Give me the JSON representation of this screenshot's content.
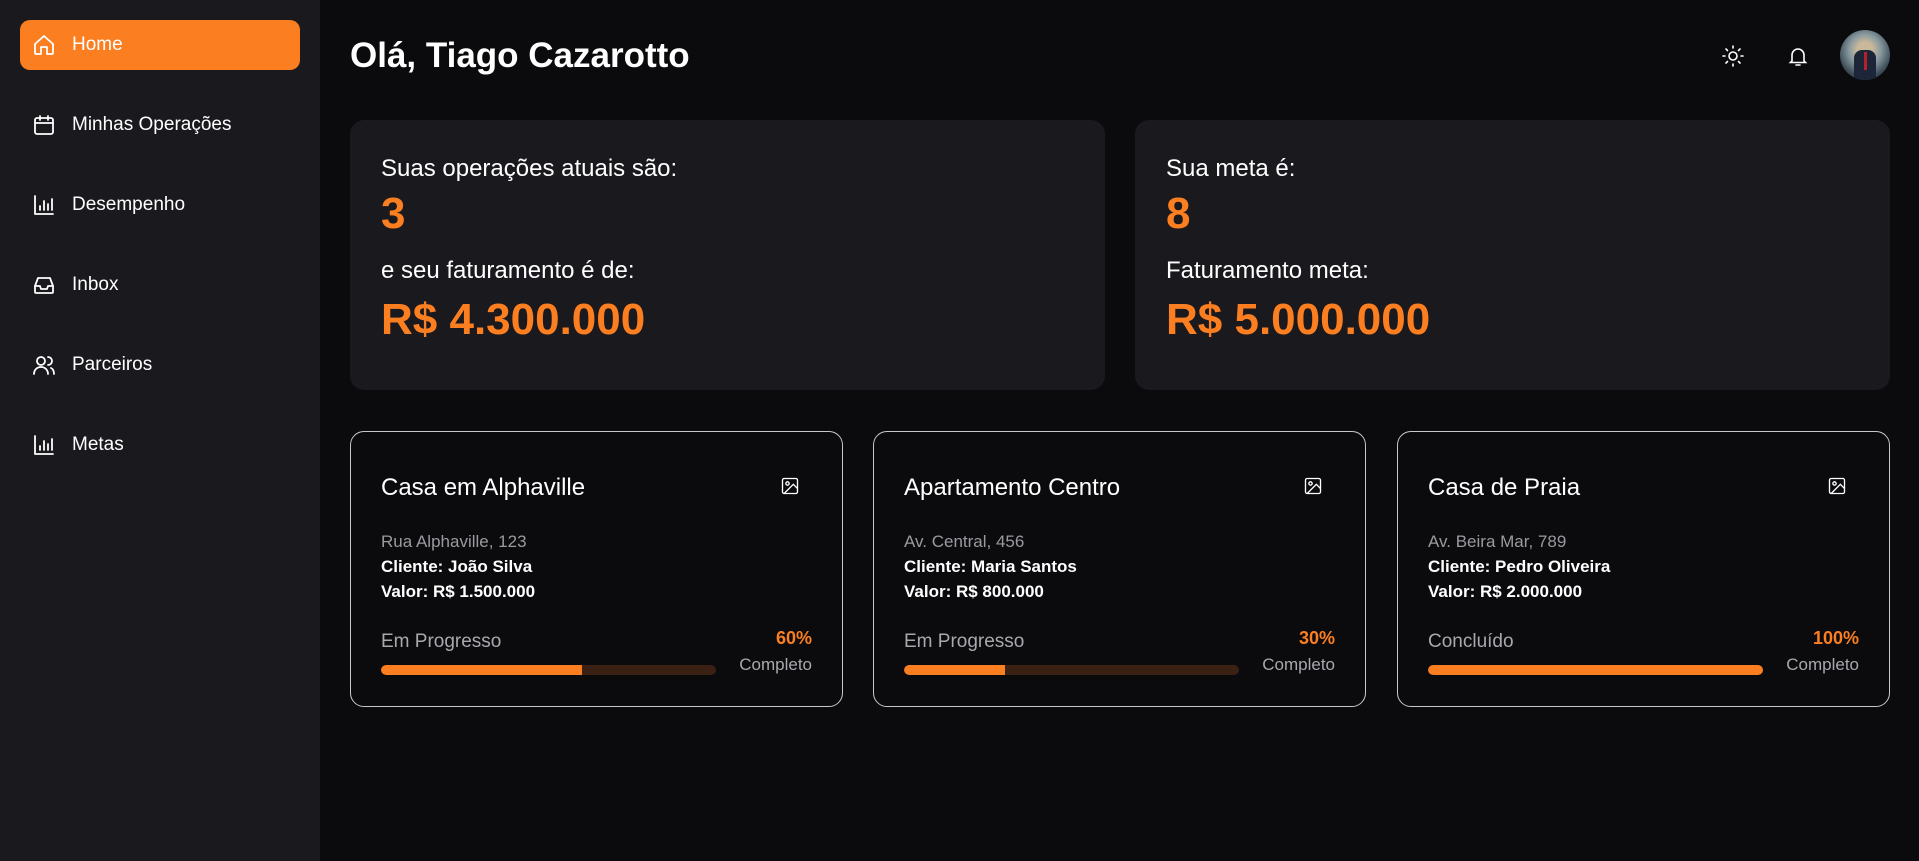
{
  "sidebar": {
    "items": [
      {
        "label": "Home",
        "icon": "home-icon",
        "active": true
      },
      {
        "label": "Minhas Operações",
        "icon": "calendar-icon"
      },
      {
        "label": "Desempenho",
        "icon": "bar-chart-icon"
      },
      {
        "label": "Inbox",
        "icon": "inbox-icon"
      },
      {
        "label": "Parceiros",
        "icon": "users-icon"
      },
      {
        "label": "Metas",
        "icon": "bar-chart-icon"
      }
    ]
  },
  "header": {
    "greeting": "Olá, Tiago Cazarotto",
    "icons": [
      "sun-icon",
      "bell-icon",
      "avatar"
    ]
  },
  "stats": {
    "current": {
      "ops_label": "Suas operações atuais são:",
      "ops_value": "3",
      "revenue_label": "e seu faturamento é de:",
      "revenue_value": "R$ 4.300.000"
    },
    "goal": {
      "ops_label": "Sua meta é:",
      "ops_value": "8",
      "revenue_label": "Faturamento meta:",
      "revenue_value": "R$ 5.000.000"
    }
  },
  "properties": [
    {
      "title": "Casa em Alphaville",
      "address": "Rua Alphaville, 123",
      "client": "Cliente: João Silva",
      "value": "Valor: R$ 1.500.000",
      "status": "Em Progresso",
      "percent_label": "60%",
      "percent": 60,
      "complete_label": "Completo"
    },
    {
      "title": "Apartamento Centro",
      "address": "Av. Central, 456",
      "client": "Cliente: Maria Santos",
      "value": "Valor: R$ 800.000",
      "status": "Em Progresso",
      "percent_label": "30%",
      "percent": 30,
      "complete_label": "Completo"
    },
    {
      "title": "Casa de Praia",
      "address": "Av. Beira Mar, 789",
      "client": "Cliente: Pedro Oliveira",
      "value": "Valor: R$ 2.000.000",
      "status": "Concluído",
      "percent_label": "100%",
      "percent": 100,
      "complete_label": "Completo"
    }
  ],
  "colors": {
    "accent": "#fb7e21",
    "sidebar_bg": "#1a191e",
    "page_bg": "#0b0b0d",
    "progress_track": "#3b2114"
  }
}
